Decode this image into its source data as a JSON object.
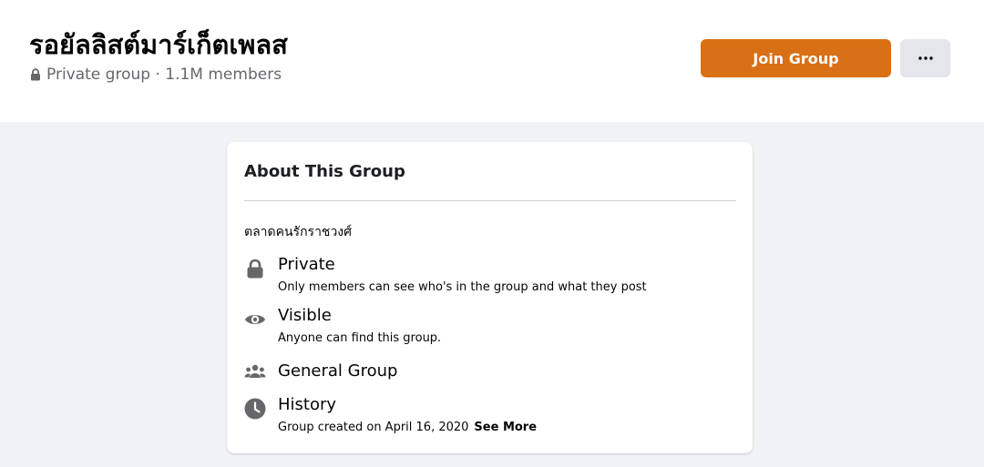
{
  "header": {
    "title": "รอยัลลิสต์มาร์เก็ตเพลส",
    "privacy_label": "Private group",
    "separator": " · ",
    "members_label": "1.1M members",
    "join_label": "Join Group",
    "more_label": "···",
    "join_color": "#d97015"
  },
  "about": {
    "title": "About This Group",
    "description": "ตลาดคนรักราชวงศ์",
    "items": [
      {
        "icon": "lock-icon",
        "title": "Private",
        "subtitle": "Only members can see who's in the group and what they post"
      },
      {
        "icon": "eye-icon",
        "title": "Visible",
        "subtitle": "Anyone can find this group."
      },
      {
        "icon": "people-icon",
        "title": "General Group",
        "subtitle": ""
      },
      {
        "icon": "clock-icon",
        "title": "History",
        "subtitle": "Group created on April 16, 2020",
        "link": "See More"
      }
    ]
  }
}
